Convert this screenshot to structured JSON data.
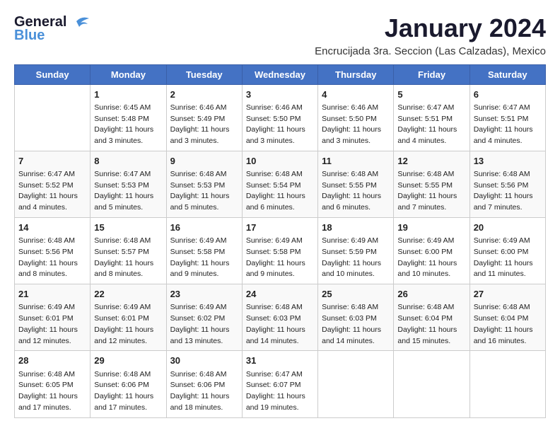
{
  "header": {
    "logo_line1": "General",
    "logo_line2": "Blue",
    "calendar_title": "January 2024",
    "subtitle": "Encrucijada 3ra. Seccion (Las Calzadas), Mexico"
  },
  "days_of_week": [
    "Sunday",
    "Monday",
    "Tuesday",
    "Wednesday",
    "Thursday",
    "Friday",
    "Saturday"
  ],
  "weeks": [
    [
      {
        "day": "",
        "content": ""
      },
      {
        "day": "1",
        "content": "Sunrise: 6:45 AM\nSunset: 5:48 PM\nDaylight: 11 hours\nand 3 minutes."
      },
      {
        "day": "2",
        "content": "Sunrise: 6:46 AM\nSunset: 5:49 PM\nDaylight: 11 hours\nand 3 minutes."
      },
      {
        "day": "3",
        "content": "Sunrise: 6:46 AM\nSunset: 5:50 PM\nDaylight: 11 hours\nand 3 minutes."
      },
      {
        "day": "4",
        "content": "Sunrise: 6:46 AM\nSunset: 5:50 PM\nDaylight: 11 hours\nand 3 minutes."
      },
      {
        "day": "5",
        "content": "Sunrise: 6:47 AM\nSunset: 5:51 PM\nDaylight: 11 hours\nand 4 minutes."
      },
      {
        "day": "6",
        "content": "Sunrise: 6:47 AM\nSunset: 5:51 PM\nDaylight: 11 hours\nand 4 minutes."
      }
    ],
    [
      {
        "day": "7",
        "content": "Sunrise: 6:47 AM\nSunset: 5:52 PM\nDaylight: 11 hours\nand 4 minutes."
      },
      {
        "day": "8",
        "content": "Sunrise: 6:47 AM\nSunset: 5:53 PM\nDaylight: 11 hours\nand 5 minutes."
      },
      {
        "day": "9",
        "content": "Sunrise: 6:48 AM\nSunset: 5:53 PM\nDaylight: 11 hours\nand 5 minutes."
      },
      {
        "day": "10",
        "content": "Sunrise: 6:48 AM\nSunset: 5:54 PM\nDaylight: 11 hours\nand 6 minutes."
      },
      {
        "day": "11",
        "content": "Sunrise: 6:48 AM\nSunset: 5:55 PM\nDaylight: 11 hours\nand 6 minutes."
      },
      {
        "day": "12",
        "content": "Sunrise: 6:48 AM\nSunset: 5:55 PM\nDaylight: 11 hours\nand 7 minutes."
      },
      {
        "day": "13",
        "content": "Sunrise: 6:48 AM\nSunset: 5:56 PM\nDaylight: 11 hours\nand 7 minutes."
      }
    ],
    [
      {
        "day": "14",
        "content": "Sunrise: 6:48 AM\nSunset: 5:56 PM\nDaylight: 11 hours\nand 8 minutes."
      },
      {
        "day": "15",
        "content": "Sunrise: 6:48 AM\nSunset: 5:57 PM\nDaylight: 11 hours\nand 8 minutes."
      },
      {
        "day": "16",
        "content": "Sunrise: 6:49 AM\nSunset: 5:58 PM\nDaylight: 11 hours\nand 9 minutes."
      },
      {
        "day": "17",
        "content": "Sunrise: 6:49 AM\nSunset: 5:58 PM\nDaylight: 11 hours\nand 9 minutes."
      },
      {
        "day": "18",
        "content": "Sunrise: 6:49 AM\nSunset: 5:59 PM\nDaylight: 11 hours\nand 10 minutes."
      },
      {
        "day": "19",
        "content": "Sunrise: 6:49 AM\nSunset: 6:00 PM\nDaylight: 11 hours\nand 10 minutes."
      },
      {
        "day": "20",
        "content": "Sunrise: 6:49 AM\nSunset: 6:00 PM\nDaylight: 11 hours\nand 11 minutes."
      }
    ],
    [
      {
        "day": "21",
        "content": "Sunrise: 6:49 AM\nSunset: 6:01 PM\nDaylight: 11 hours\nand 12 minutes."
      },
      {
        "day": "22",
        "content": "Sunrise: 6:49 AM\nSunset: 6:01 PM\nDaylight: 11 hours\nand 12 minutes."
      },
      {
        "day": "23",
        "content": "Sunrise: 6:49 AM\nSunset: 6:02 PM\nDaylight: 11 hours\nand 13 minutes."
      },
      {
        "day": "24",
        "content": "Sunrise: 6:48 AM\nSunset: 6:03 PM\nDaylight: 11 hours\nand 14 minutes."
      },
      {
        "day": "25",
        "content": "Sunrise: 6:48 AM\nSunset: 6:03 PM\nDaylight: 11 hours\nand 14 minutes."
      },
      {
        "day": "26",
        "content": "Sunrise: 6:48 AM\nSunset: 6:04 PM\nDaylight: 11 hours\nand 15 minutes."
      },
      {
        "day": "27",
        "content": "Sunrise: 6:48 AM\nSunset: 6:04 PM\nDaylight: 11 hours\nand 16 minutes."
      }
    ],
    [
      {
        "day": "28",
        "content": "Sunrise: 6:48 AM\nSunset: 6:05 PM\nDaylight: 11 hours\nand 17 minutes."
      },
      {
        "day": "29",
        "content": "Sunrise: 6:48 AM\nSunset: 6:06 PM\nDaylight: 11 hours\nand 17 minutes."
      },
      {
        "day": "30",
        "content": "Sunrise: 6:48 AM\nSunset: 6:06 PM\nDaylight: 11 hours\nand 18 minutes."
      },
      {
        "day": "31",
        "content": "Sunrise: 6:47 AM\nSunset: 6:07 PM\nDaylight: 11 hours\nand 19 minutes."
      },
      {
        "day": "",
        "content": ""
      },
      {
        "day": "",
        "content": ""
      },
      {
        "day": "",
        "content": ""
      }
    ]
  ]
}
